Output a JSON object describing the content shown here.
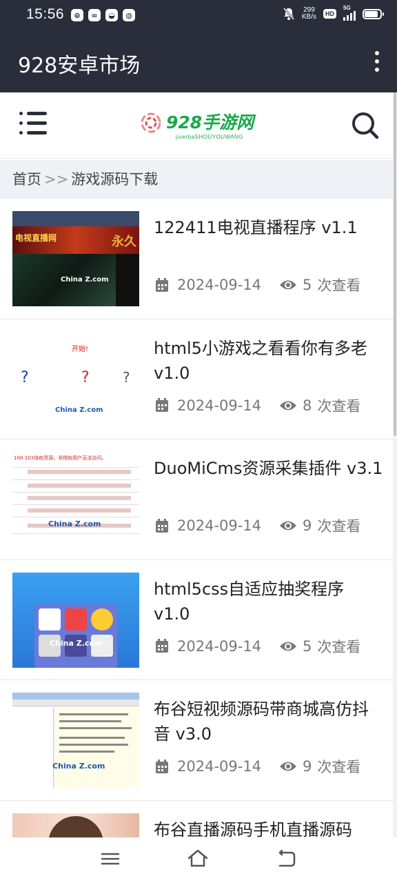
{
  "status_bar": {
    "time": "15:56",
    "net_speed_value": "299",
    "net_speed_unit": "KB/s",
    "hd_label": "HD",
    "network_type": "5G",
    "battery_level": 0.8
  },
  "app_bar": {
    "title": "928安卓市场",
    "menu_icon": "more-vert-icon"
  },
  "site_header": {
    "menu_icon": "menu-list-icon",
    "logo_text": "928手游网",
    "logo_sub": "jiuerbaSHOUYOUWANG",
    "search_icon": "search-icon"
  },
  "breadcrumb": {
    "home": "首页",
    "separator": ">>",
    "current": "游戏源码下载"
  },
  "items": [
    {
      "title": "122411电视直播程序 v1.1",
      "date": "2024-09-14",
      "views": "5",
      "views_unit": "次查看",
      "thumb_text": "电视直播网"
    },
    {
      "title": "html5小游戏之看看你有多老 v1.0",
      "date": "2024-09-14",
      "views": "8",
      "views_unit": "次查看",
      "thumb_text": "开始!"
    },
    {
      "title": "DuoMiCms资源采集插件 v3.1",
      "date": "2024-09-14",
      "views": "9",
      "views_unit": "次查看",
      "thumb_text": "100-103倍权资源，非授权用户无法访问。"
    },
    {
      "title": "html5css自适应抽奖程序 v1.0",
      "date": "2024-09-14",
      "views": "5",
      "views_unit": "次查看",
      "thumb_text": ""
    },
    {
      "title": "布谷短视频源码带商城高仿抖音 v3.0",
      "date": "2024-09-14",
      "views": "9",
      "views_unit": "次查看",
      "thumb_text": ""
    },
    {
      "title": "布谷直播源码手机直播源码",
      "date": "",
      "views": "",
      "views_unit": "",
      "thumb_text": ""
    }
  ],
  "watermark": "China Z.com",
  "nav_bar": {
    "recents_icon": "recents-icon",
    "home_icon": "home-icon",
    "back_icon": "back-icon"
  },
  "colors": {
    "bar_bg": "#2a2d3a",
    "logo_green": "#1aa84a",
    "breadcrumb_bg": "#eef1f5"
  }
}
